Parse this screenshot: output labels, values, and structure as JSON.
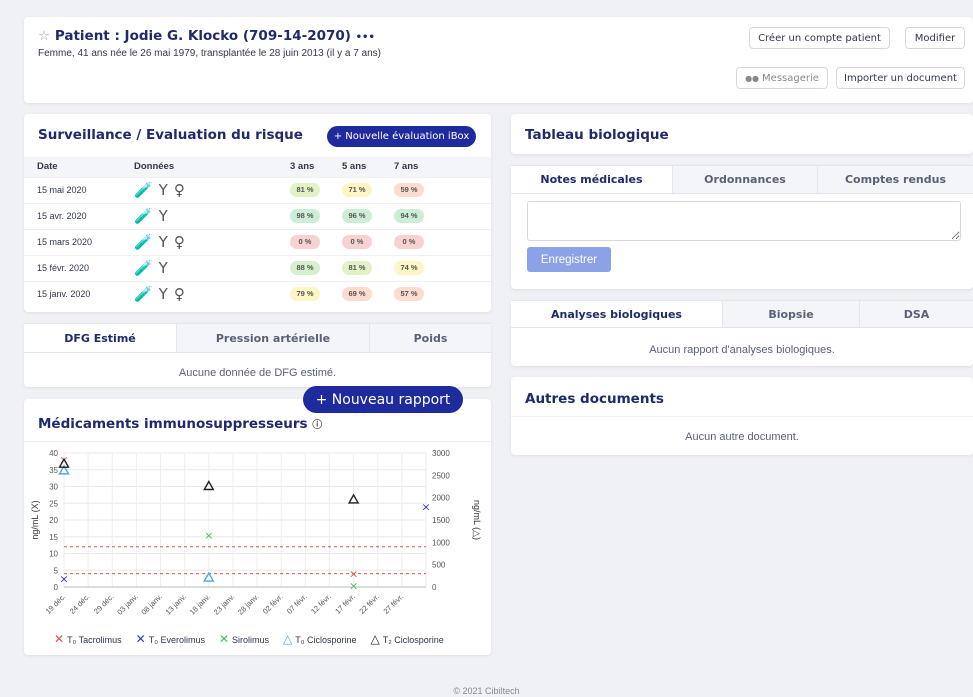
{
  "header": {
    "star_icon": "☆",
    "title": "Patient : Jodie G. Klocko (709-14-2070)",
    "more": "•••",
    "subtitle": "Femme, 41 ans née le 26 mai 1979, transplantée le 28 juin 2013 (il y a 7 ans)",
    "create_account_label": "Créer un compte patient",
    "modify_label": "Modifier",
    "messaging_label": "Messagerie",
    "import_doc_label": "Importer un document"
  },
  "surveillance": {
    "title": "Surveillance / Evaluation du risque",
    "new_eval_label": "+ Nouvelle évaluation iBox",
    "columns": [
      "Date",
      "Données",
      "3 ans",
      "5 ans",
      "7 ans"
    ],
    "rows": [
      {
        "date": "15 mai 2020",
        "icons": "🧪Y♀",
        "v3": "81 %",
        "v5": "71 %",
        "v7": "59 %",
        "c3": "#e3f2c4",
        "c5": "#fbf6c4",
        "c7": "#fcdccf"
      },
      {
        "date": "15 avr. 2020",
        "icons": "🧪Y",
        "v3": "98 %",
        "v5": "96 %",
        "v7": "94 %",
        "c3": "#cdeed6",
        "c5": "#cdeed6",
        "c7": "#cdeed6"
      },
      {
        "date": "15 mars 2020",
        "icons": "🧪Y♀",
        "v3": "0 %",
        "v5": "0 %",
        "v7": "0 %",
        "c3": "#f8d2d2",
        "c5": "#f8d2d2",
        "c7": "#f8d2d2"
      },
      {
        "date": "15 févr. 2020",
        "icons": "🧪Y",
        "v3": "88 %",
        "v5": "81 %",
        "v7": "74 %",
        "c3": "#d6efcd",
        "c5": "#e3f2c4",
        "c7": "#fbf6c4"
      },
      {
        "date": "15 janv. 2020",
        "icons": "🧪Y♀",
        "v3": "79 %",
        "v5": "69 %",
        "v7": "57 %",
        "c3": "#fbf6c4",
        "c5": "#fcdccf",
        "c7": "#fcdccf"
      }
    ]
  },
  "dfg": {
    "tabs": [
      "DFG Estimé",
      "Pression artérielle",
      "Poids"
    ],
    "empty": "Aucune donnée de DFG estimé."
  },
  "new_report_label": "+ Nouveau rapport",
  "meds": {
    "title": "Médicaments immunosuppresseurs",
    "info_icon": "ⓘ"
  },
  "chart_data": {
    "type": "scatter",
    "x_ticks": [
      "19 déc.",
      "24 déc.",
      "29 déc.",
      "03 janv.",
      "08 janv.",
      "13 janv.",
      "18 janv.",
      "23 janv.",
      "28 janv.",
      "02 févr.",
      "07 févr.",
      "12 févr.",
      "17 févr.",
      "22 févr.",
      "27 févr."
    ],
    "ylabel_left": "ng/mL (X)",
    "ylabel_right": "ng/mL (△)",
    "ylim_left": [
      0,
      40
    ],
    "ylim_right": [
      0,
      3000
    ],
    "y_ticks_left": [
      0,
      5,
      10,
      15,
      20,
      25,
      30,
      35,
      40
    ],
    "y_ticks_right": [
      0,
      500,
      1000,
      1500,
      2000,
      2500,
      3000
    ],
    "reference_lines_left": [
      4,
      12
    ],
    "series": [
      {
        "name": "T₀ Tacrolimus",
        "marker": "x",
        "color": "#e05050",
        "axis": "left",
        "points": [
          [
            "19 déc.",
            38
          ],
          [
            "17 févr.",
            4
          ]
        ]
      },
      {
        "name": "T₀ Everolimus",
        "marker": "x",
        "color": "#2a3ab0",
        "axis": "left",
        "points": [
          [
            "19 déc.",
            2.5
          ],
          [
            "2 mars",
            24
          ]
        ]
      },
      {
        "name": "Sirolimus",
        "marker": "x",
        "color": "#3cbf5a",
        "axis": "left",
        "points": [
          [
            "18 janv.",
            15.5
          ],
          [
            "17 févr.",
            0.5
          ]
        ]
      },
      {
        "name": "T₀ Ciclosporine",
        "marker": "triangle",
        "color": "#4aa8e8",
        "axis": "right",
        "points": [
          [
            "19 déc.",
            2600
          ],
          [
            "18 janv.",
            200
          ]
        ]
      },
      {
        "name": "T₂ Ciclosporine",
        "marker": "triangle",
        "color": "#222222",
        "axis": "right",
        "points": [
          [
            "19 déc.",
            2750
          ],
          [
            "18 janv.",
            2250
          ],
          [
            "17 févr.",
            1950
          ]
        ]
      }
    ],
    "grid": true,
    "legend_position": "bottom"
  },
  "bio": {
    "title": "Tableau biologique",
    "tabs": [
      "Notes médicales",
      "Ordonnances",
      "Comptes rendus"
    ],
    "save_label": "Enregistrer"
  },
  "analyses": {
    "tabs": [
      "Analyses biologiques",
      "Biopsie",
      "DSA"
    ],
    "empty": "Aucun rapport d'analyses biologiques."
  },
  "others": {
    "title": "Autres documents",
    "empty": "Aucun autre document."
  },
  "footer": "© 2021 Cibiltech"
}
